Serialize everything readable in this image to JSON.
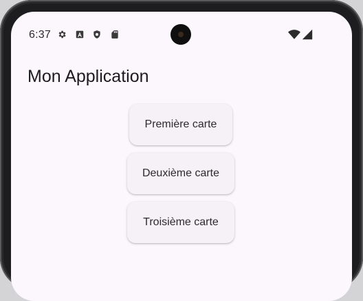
{
  "status_bar": {
    "time": "6:37",
    "icons": [
      "settings-icon",
      "font-icon",
      "shield-icon",
      "sd-card-icon"
    ],
    "right_icons": [
      "wifi-icon",
      "signal-icon"
    ]
  },
  "app_bar": {
    "title": "Mon Application"
  },
  "cards": [
    {
      "label": "Première carte"
    },
    {
      "label": "Deuxième carte"
    },
    {
      "label": "Troisième carte"
    }
  ]
}
